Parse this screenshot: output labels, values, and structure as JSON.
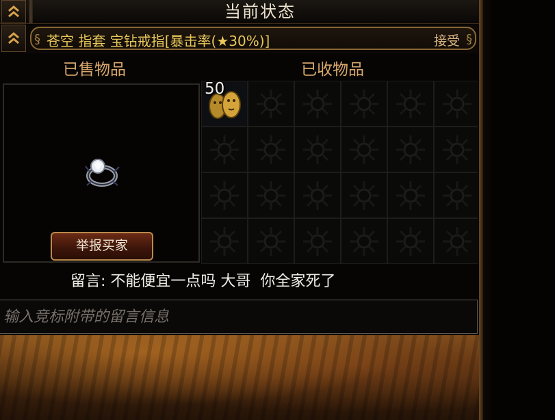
{
  "header": {
    "title": "当前状态",
    "collapse_icon": "double-chevron-up-icon"
  },
  "offer": {
    "text": "苍空 指套 宝钻戒指[暴击率(★30%)]",
    "accept_label": "接受",
    "expand_icon": "double-chevron-up-icon"
  },
  "sold": {
    "label": "已售物品",
    "item_icon": "diamond-ring-icon",
    "report_button": "举报买家"
  },
  "received": {
    "label": "已收物品",
    "rows": 4,
    "cols": 6,
    "items": [
      {
        "icon": "golden-faces-orb-icon",
        "count": "50"
      }
    ]
  },
  "message": {
    "text": "留言: 不能便宜一点吗 大哥  你全家死了"
  },
  "input": {
    "placeholder": "输入竞标附带的留言信息",
    "value": ""
  },
  "colors": {
    "accent_gold": "#e8c85a",
    "label_orange": "#d9a86c",
    "button_red": "#5a2010"
  }
}
